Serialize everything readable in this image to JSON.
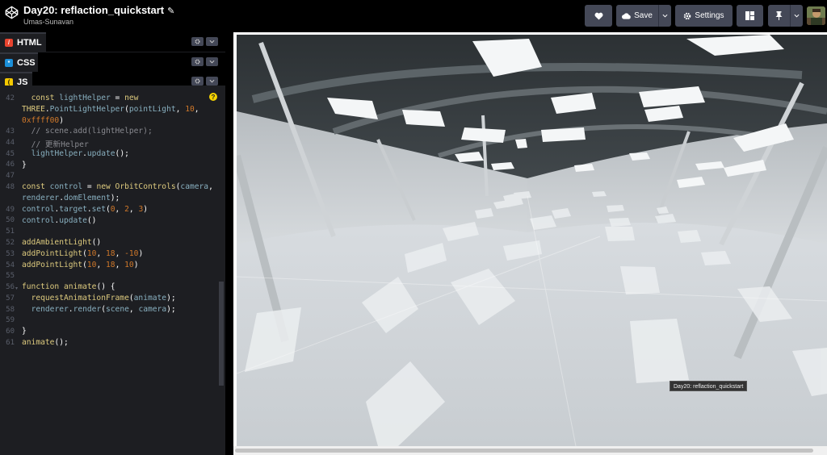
{
  "header": {
    "title": "Day20: reflaction_quickstart",
    "author": "Umas-Sunavan",
    "save_label": "Save",
    "settings_label": "Settings"
  },
  "panes": {
    "html_label": "HTML",
    "css_label": "CSS",
    "js_label": "JS"
  },
  "code": {
    "line_numbers": [
      "42",
      "43",
      "44",
      "45",
      "46",
      "47",
      "48",
      "49",
      "50",
      "51",
      "52",
      "53",
      "54",
      "55",
      "56",
      "57",
      "58",
      "59",
      "60",
      "61"
    ],
    "hint_label": "?"
  },
  "preview": {
    "tooltip": "Day20: reflaction_quickstart"
  },
  "colors": {
    "header_button": "#444857",
    "editor_bg": "#1d1e22",
    "html_icon": "#e8442f",
    "css_icon": "#1b8fd9",
    "js_icon": "#f5c900"
  },
  "icons": {
    "logo": "codepen-logo-icon",
    "heart": "heart-icon",
    "save": "cloud-icon",
    "settings": "gear-icon",
    "layout": "layout-icon",
    "pin": "pin-icon",
    "edit": "pencil-icon"
  }
}
